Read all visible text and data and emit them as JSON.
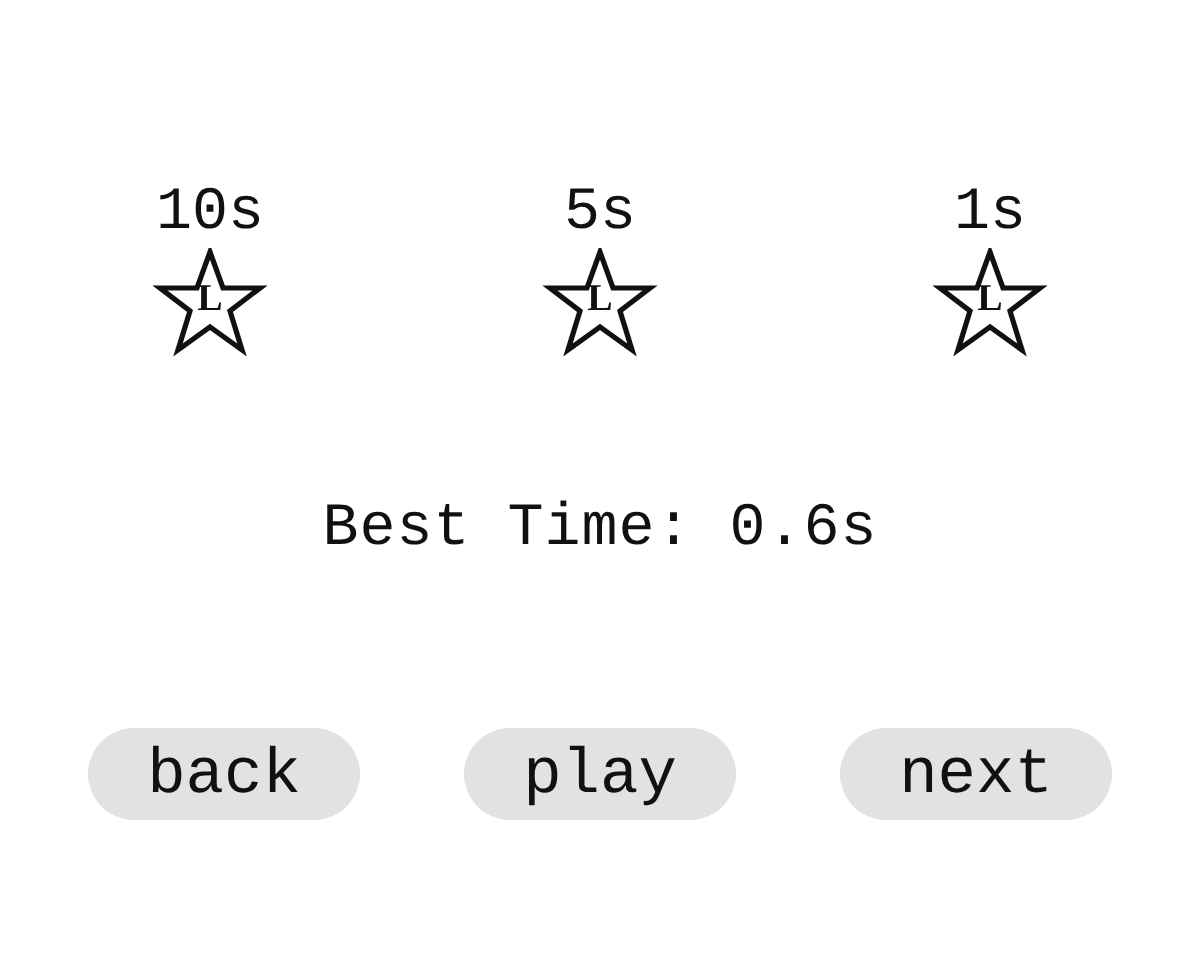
{
  "goals": [
    {
      "time": "10s",
      "letter": "L"
    },
    {
      "time": "5s",
      "letter": "L"
    },
    {
      "time": "1s",
      "letter": "L"
    }
  ],
  "best_time": "Best Time: 0.6s",
  "buttons": [
    "back",
    "play",
    "next"
  ]
}
